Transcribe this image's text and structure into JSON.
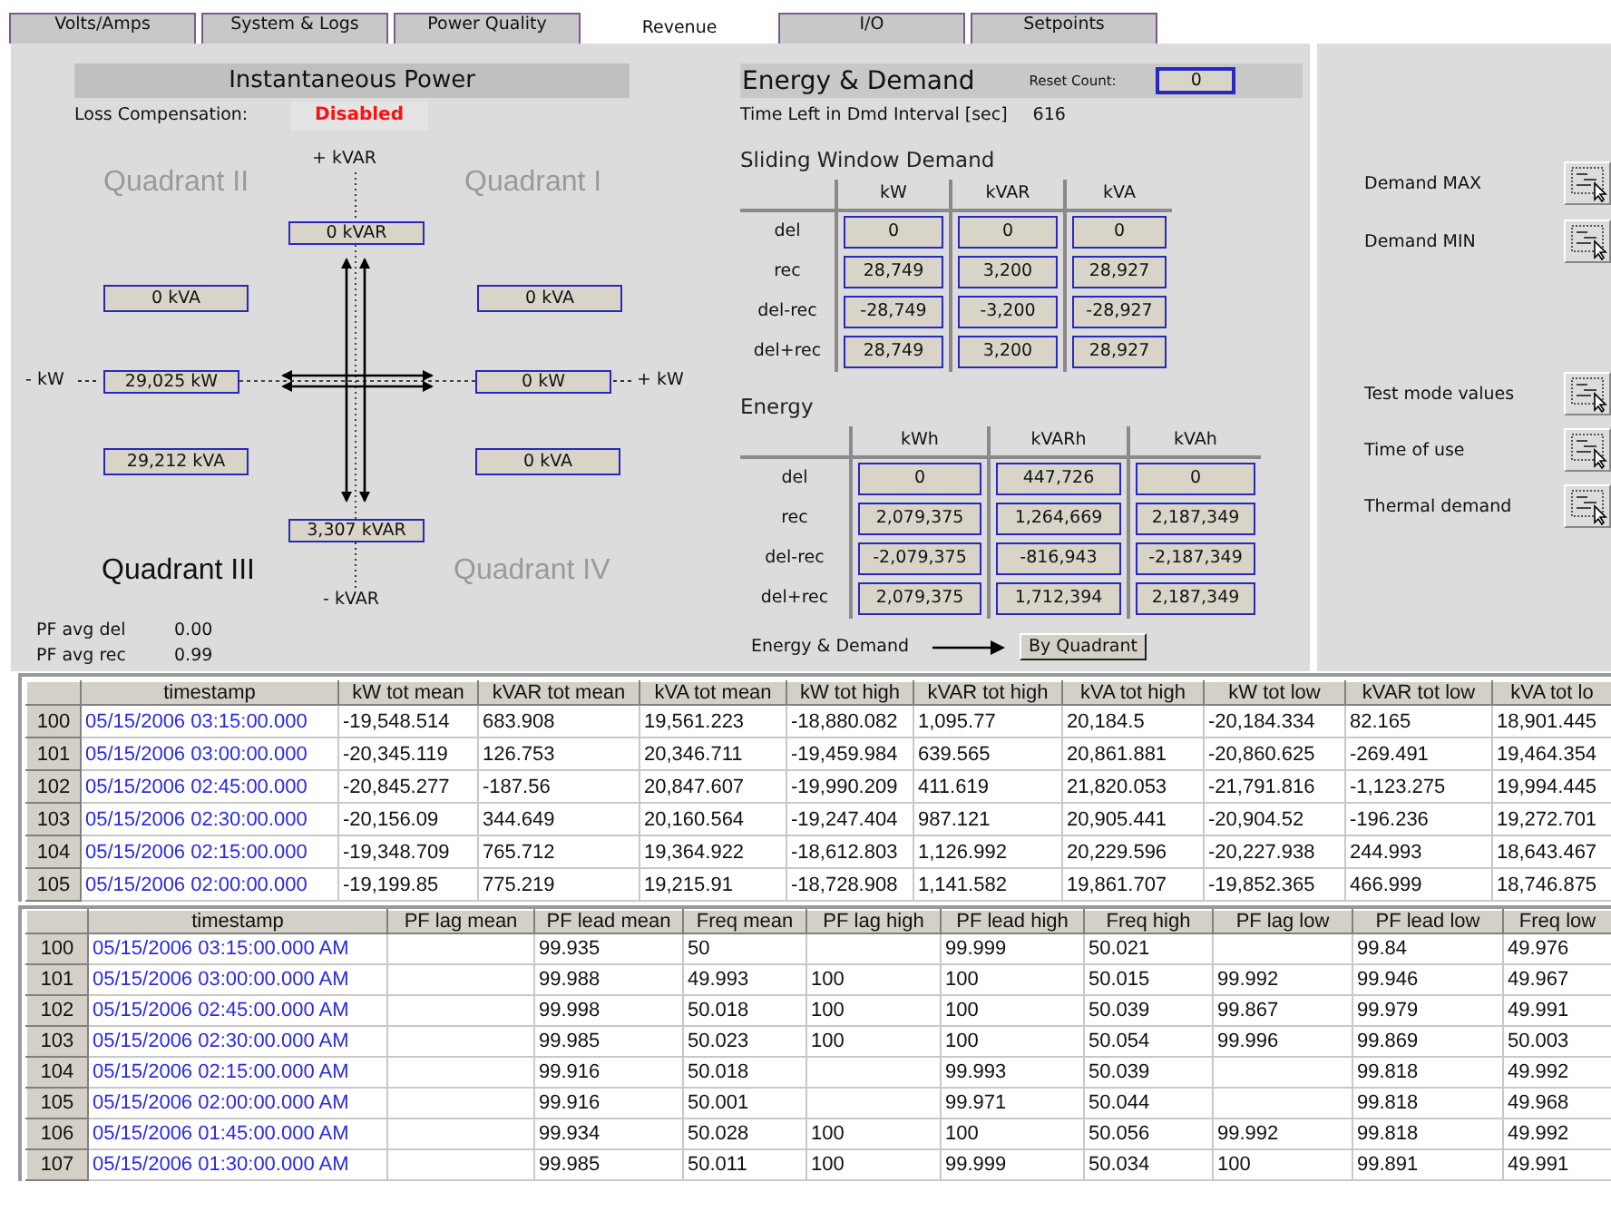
{
  "tabs": [
    {
      "label": "Volts/Amps",
      "selected": false
    },
    {
      "label": "System & Logs",
      "selected": false
    },
    {
      "label": "Power Quality",
      "selected": false
    },
    {
      "label": "Revenue",
      "selected": true
    },
    {
      "label": "I/O",
      "selected": false
    },
    {
      "label": "Setpoints",
      "selected": false
    }
  ],
  "instantaneous_power": {
    "title": "Instantaneous Power",
    "loss_compensation": {
      "label": "Loss Compensation:",
      "value": "Disabled"
    },
    "axis_labels": {
      "plus_kvar": "+ kVAR",
      "minus_kvar": "- kVAR",
      "minus_kw": "- kW",
      "plus_kw": "+ kW"
    },
    "quadrants": [
      {
        "label": "Quadrant II",
        "highlighted": false
      },
      {
        "label": "Quadrant I",
        "highlighted": false
      },
      {
        "label": "Quadrant III",
        "highlighted": true
      },
      {
        "label": "Quadrant IV",
        "highlighted": false
      }
    ],
    "readings": {
      "plus_kvar": "0 kVAR",
      "q2_kva": "0 kVA",
      "q1_kva": "0 kVA",
      "minus_kw": "29,025 kW",
      "plus_kw": "0 kW",
      "q3_kva": "29,212 kVA",
      "q4_kva": "0 kVA",
      "minus_kvar": "3,307 kVAR"
    },
    "pf": [
      {
        "label": "PF avg del",
        "value": "0.00"
      },
      {
        "label": "PF avg rec",
        "value": "0.99"
      }
    ]
  },
  "energy_demand": {
    "title": "Energy & Demand",
    "reset_count": {
      "label": "Reset Count:",
      "value": "0"
    },
    "time_left": {
      "label": "Time Left in Dmd Interval [sec]",
      "value": "616"
    },
    "sliding_window": {
      "title": "Sliding Window Demand",
      "columns": [
        "kW",
        "kVAR",
        "kVA"
      ],
      "rows": [
        {
          "label": "del",
          "values": [
            "0",
            "0",
            "0"
          ]
        },
        {
          "label": "rec",
          "values": [
            "28,749",
            "3,200",
            "28,927"
          ]
        },
        {
          "label": "del-rec",
          "values": [
            "-28,749",
            "-3,200",
            "-28,927"
          ]
        },
        {
          "label": "del+rec",
          "values": [
            "28,749",
            "3,200",
            "28,927"
          ]
        }
      ]
    },
    "energy": {
      "title": "Energy",
      "columns": [
        "kWh",
        "kVARh",
        "kVAh"
      ],
      "rows": [
        {
          "label": "del",
          "values": [
            "0",
            "447,726",
            "0"
          ]
        },
        {
          "label": "rec",
          "values": [
            "2,079,375",
            "1,264,669",
            "2,187,349"
          ]
        },
        {
          "label": "del-rec",
          "values": [
            "-2,079,375",
            "-816,943",
            "-2,187,349"
          ]
        },
        {
          "label": "del+rec",
          "values": [
            "2,079,375",
            "1,712,394",
            "2,187,349"
          ]
        }
      ]
    },
    "footer": {
      "label": "Energy & Demand",
      "button": "By Quadrant"
    }
  },
  "action_groups": [
    [
      {
        "label": "Demand MAX"
      },
      {
        "label": "Demand MIN"
      }
    ],
    [
      {
        "label": "Test mode values"
      },
      {
        "label": "Time of use"
      },
      {
        "label": "Thermal demand"
      }
    ]
  ],
  "demand_log": {
    "columns": [
      "timestamp",
      "kW tot mean",
      "kVAR tot mean",
      "kVA tot mean",
      "kW tot high",
      "kVAR tot high",
      "kVA tot high",
      "kW tot low",
      "kVAR tot low",
      "kVA tot lo"
    ],
    "rows": [
      {
        "number": "100",
        "cells": [
          "05/15/2006 03:15:00.000",
          "-19,548.514",
          "683.908",
          "19,561.223",
          "-18,880.082",
          "1,095.77",
          "20,184.5",
          "-20,184.334",
          "82.165",
          "18,901.445"
        ]
      },
      {
        "number": "101",
        "cells": [
          "05/15/2006 03:00:00.000",
          "-20,345.119",
          "126.753",
          "20,346.711",
          "-19,459.984",
          "639.565",
          "20,861.881",
          "-20,860.625",
          "-269.491",
          "19,464.354"
        ]
      },
      {
        "number": "102",
        "cells": [
          "05/15/2006 02:45:00.000",
          "-20,845.277",
          "-187.56",
          "20,847.607",
          "-19,990.209",
          "411.619",
          "21,820.053",
          "-21,791.816",
          "-1,123.275",
          "19,994.445"
        ]
      },
      {
        "number": "103",
        "cells": [
          "05/15/2006 02:30:00.000",
          "-20,156.09",
          "344.649",
          "20,160.564",
          "-19,247.404",
          "987.121",
          "20,905.441",
          "-20,904.52",
          "-196.236",
          "19,272.701"
        ]
      },
      {
        "number": "104",
        "cells": [
          "05/15/2006 02:15:00.000",
          "-19,348.709",
          "765.712",
          "19,364.922",
          "-18,612.803",
          "1,126.992",
          "20,229.596",
          "-20,227.938",
          "244.993",
          "18,643.467"
        ]
      },
      {
        "number": "105",
        "cells": [
          "05/15/2006 02:00:00.000",
          "-19,199.85",
          "775.219",
          "19,215.91",
          "-18,728.908",
          "1,141.582",
          "19,861.707",
          "-19,852.365",
          "466.999",
          "18,746.875"
        ]
      }
    ]
  },
  "pf_log": {
    "columns": [
      "timestamp",
      "PF lag mean",
      "PF lead mean",
      "Freq mean",
      "PF lag high",
      "PF lead high",
      "Freq high",
      "PF lag low",
      "PF lead low",
      "Freq low"
    ],
    "rows": [
      {
        "number": "100",
        "cells": [
          "05/15/2006 03:15:00.000 AM",
          "",
          "99.935",
          "50",
          "",
          "99.999",
          "50.021",
          "",
          "99.84",
          "49.976"
        ]
      },
      {
        "number": "101",
        "cells": [
          "05/15/2006 03:00:00.000 AM",
          "",
          "99.988",
          "49.993",
          "100",
          "100",
          "50.015",
          "99.992",
          "99.946",
          "49.967"
        ]
      },
      {
        "number": "102",
        "cells": [
          "05/15/2006 02:45:00.000 AM",
          "",
          "99.998",
          "50.018",
          "100",
          "100",
          "50.039",
          "99.867",
          "99.979",
          "49.991"
        ]
      },
      {
        "number": "103",
        "cells": [
          "05/15/2006 02:30:00.000 AM",
          "",
          "99.985",
          "50.023",
          "100",
          "100",
          "50.054",
          "99.996",
          "99.869",
          "50.003"
        ]
      },
      {
        "number": "104",
        "cells": [
          "05/15/2006 02:15:00.000 AM",
          "",
          "99.916",
          "50.018",
          "",
          "99.993",
          "50.039",
          "",
          "99.818",
          "49.992"
        ]
      },
      {
        "number": "105",
        "cells": [
          "05/15/2006 02:00:00.000 AM",
          "",
          "99.916",
          "50.001",
          "",
          "99.971",
          "50.044",
          "",
          "99.818",
          "49.968"
        ]
      },
      {
        "number": "106",
        "cells": [
          "05/15/2006 01:45:00.000 AM",
          "",
          "99.934",
          "50.028",
          "100",
          "100",
          "50.056",
          "99.992",
          "99.818",
          "49.992"
        ]
      },
      {
        "number": "107",
        "cells": [
          "05/15/2006 01:30:00.000 AM",
          "",
          "99.985",
          "50.011",
          "100",
          "99.999",
          "50.034",
          "100",
          "99.891",
          "49.991"
        ]
      }
    ]
  }
}
